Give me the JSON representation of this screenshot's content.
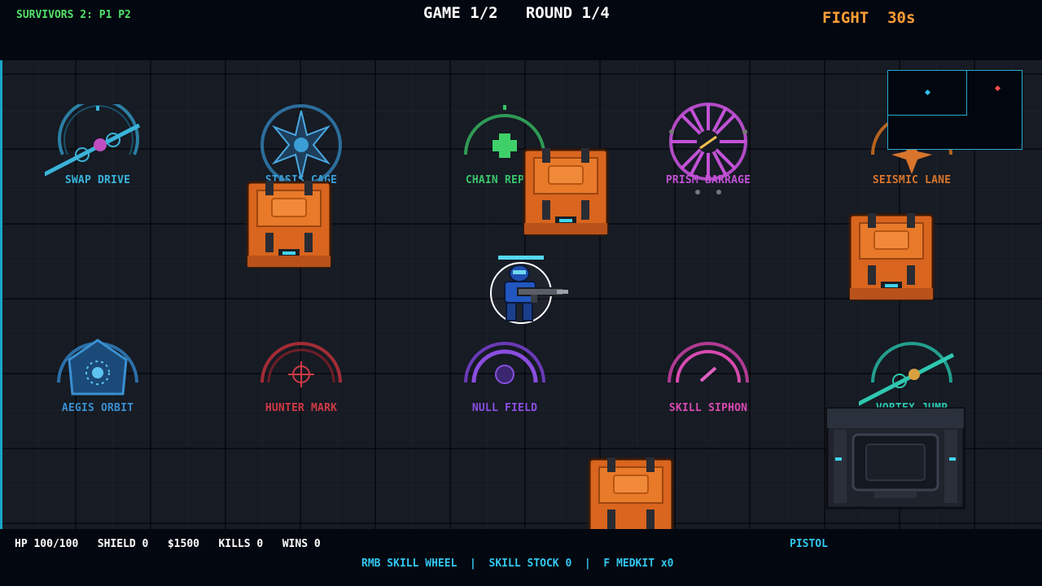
{
  "hud": {
    "survivors": "SURVIVORS 2: P1  P2",
    "game_round": "GAME 1/2   ROUND 1/4",
    "fight": "FIGHT  30s"
  },
  "skills": [
    {
      "name": "SWAP DRIVE",
      "color": "#3ab3d9",
      "icon": "swap-drive-icon"
    },
    {
      "name": "STASIS CAGE",
      "color": "#3b9ed6",
      "icon": "stasis-cage-icon"
    },
    {
      "name": "CHAIN REPAIR",
      "color": "#39c46a",
      "icon": "chain-repair-icon"
    },
    {
      "name": "PRISM BARRAGE",
      "color": "#c252d6",
      "icon": "prism-barrage-icon"
    },
    {
      "name": "SEISMIC LANE",
      "color": "#d8742b",
      "icon": "seismic-lane-icon"
    },
    {
      "name": "AEGIS ORBIT",
      "color": "#3a8fd0",
      "icon": "aegis-orbit-icon"
    },
    {
      "name": "HUNTER MARK",
      "color": "#cf3a45",
      "icon": "hunter-mark-icon"
    },
    {
      "name": "NULL FIELD",
      "color": "#8a4ee0",
      "icon": "null-field-icon"
    },
    {
      "name": "SKILL SIPHON",
      "color": "#d84ab0",
      "icon": "skill-siphon-icon"
    },
    {
      "name": "VORTEX JUMP",
      "color": "#2fc7b0",
      "icon": "vortex-jump-icon"
    }
  ],
  "player": {
    "health_fraction": 1.0
  },
  "minimap": {
    "self_color": "#2fc3f0",
    "enemy_color": "#ff4b4b"
  },
  "status": {
    "stats": "HP 100/100   SHIELD 0   $1500   KILLS 0   WINS 0",
    "weapon": "PISTOL",
    "controls": "RMB SKILL WHEEL  |  SKILL STOCK 0  |  F MEDKIT x0"
  }
}
